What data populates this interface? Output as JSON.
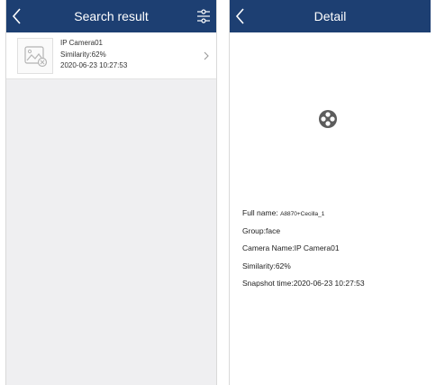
{
  "search": {
    "title": "Search result",
    "results": [
      {
        "camera": "IP Camera01",
        "similarity": "Similarity:62%",
        "time": "2020-06-23  10:27:53"
      }
    ]
  },
  "detail": {
    "title": "Detail",
    "full_name_label": "Full name:",
    "full_name_value": "A8870+Cecilla_1",
    "group": "Group:face",
    "camera_name": "Camera Name:IP Camera01",
    "similarity": "Similarity:62%",
    "snapshot_time": "Snapshot time:2020-06-23  10:27:53"
  },
  "colors": {
    "header": "#1d3f72",
    "list_background": "#efeff1"
  },
  "icons": {
    "back": "chevron-left-icon",
    "filter": "filter-sliders-icon",
    "thumbnail": "image-placeholder-icon",
    "loading": "loading-spinner-icon",
    "row_arrow": "chevron-right-icon"
  }
}
